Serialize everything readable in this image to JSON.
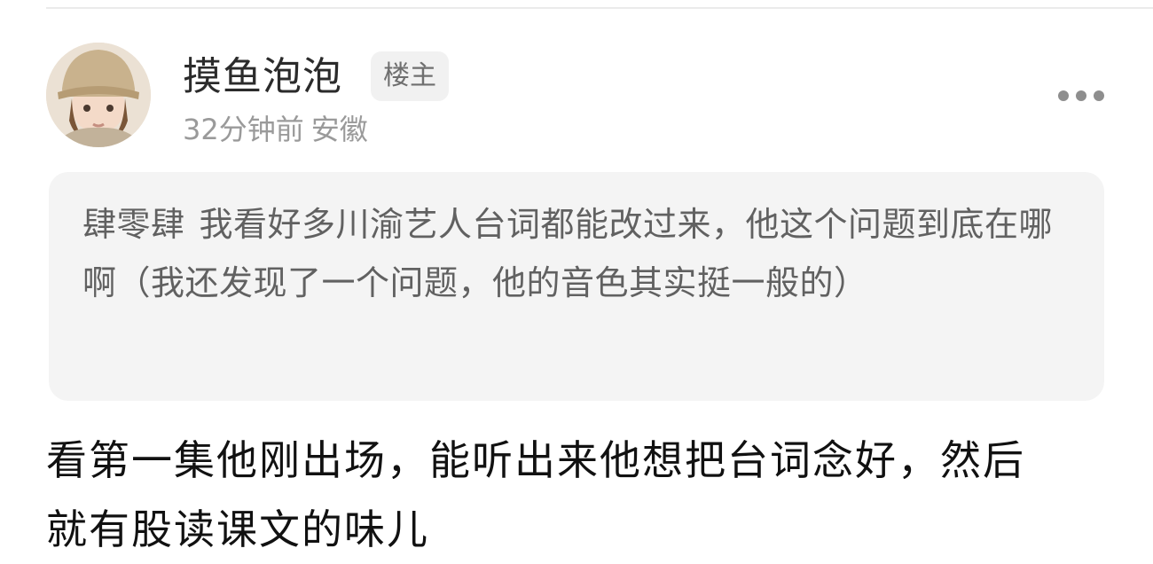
{
  "post": {
    "username": "摸鱼泡泡",
    "badge": "楼主",
    "time": "32分钟前",
    "location": "安徽"
  },
  "quote": {
    "author": "肆零肆",
    "text": "我看好多川渝艺人台词都能改过来，他这个问题到底在哪啊（我还发现了一个问题，他的音色其实挺一般的）"
  },
  "comment": {
    "text": "看第一集他刚出场，能听出来他想把台词念好，然后就有股读课文的味儿"
  },
  "icons": {
    "more": "more-horizontal-icon",
    "avatar": "avatar-image"
  },
  "colors": {
    "username": "#2b2b2b",
    "meta": "#9a9a9a",
    "quote_bg": "#f4f4f4",
    "quote_text": "#616161",
    "badge_bg": "#f1f1f1",
    "comment_text": "#111111"
  }
}
